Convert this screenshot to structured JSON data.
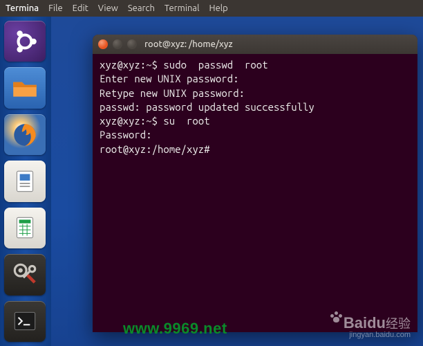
{
  "menubar": {
    "app": "Termina",
    "items": [
      "File",
      "Edit",
      "View",
      "Search",
      "Terminal",
      "Help"
    ]
  },
  "launcher": {
    "items": [
      {
        "name": "ubuntu-dash",
        "icon": "ubuntu"
      },
      {
        "name": "nautilus-files",
        "icon": "files"
      },
      {
        "name": "firefox",
        "icon": "firefox"
      },
      {
        "name": "libreoffice-writer",
        "icon": "writer"
      },
      {
        "name": "libreoffice-calc",
        "icon": "calc"
      },
      {
        "name": "system-settings",
        "icon": "settings"
      },
      {
        "name": "terminal",
        "icon": "terminal"
      }
    ]
  },
  "terminal_window": {
    "title": "root@xyz: /home/xyz",
    "lines": [
      "xyz@xyz:~$ sudo  passwd  root",
      "Enter new UNIX password:",
      "Retype new UNIX password:",
      "passwd: password updated successfully",
      "xyz@xyz:~$ su  root",
      "Password:",
      "root@xyz:/home/xyz#"
    ]
  },
  "watermarks": {
    "url": "www.9969.net",
    "baidu_main": "Baidu",
    "baidu_cn": "经验",
    "baidu_sub": "jingyan.baidu.com"
  }
}
